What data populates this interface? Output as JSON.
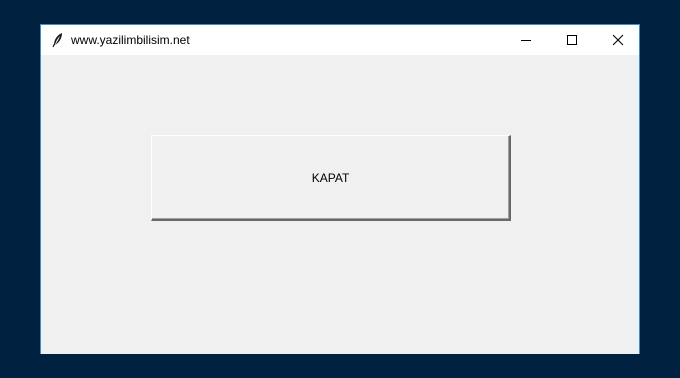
{
  "window": {
    "title": "www.yazilimbilisim.net",
    "icon": "feather-icon",
    "controls": {
      "minimize": "minimize-icon",
      "maximize": "maximize-icon",
      "close": "close-icon"
    }
  },
  "main": {
    "kapat_button_label": "KAPAT"
  },
  "colors": {
    "desktop_background": "#002240",
    "window_border": "#3a8fd0",
    "titlebar_background": "#ffffff",
    "client_background": "#f0f0f0"
  }
}
